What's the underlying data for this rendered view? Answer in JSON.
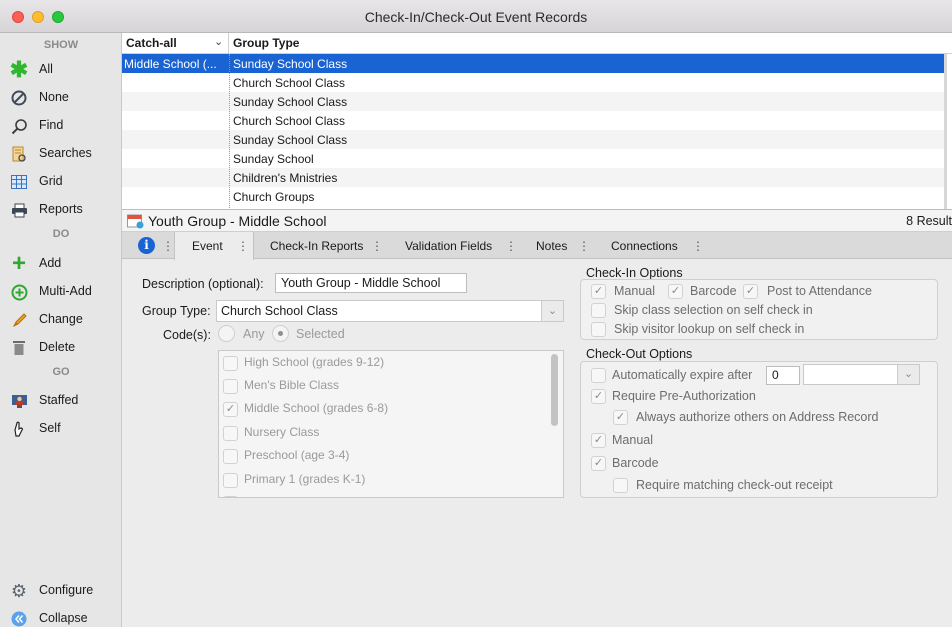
{
  "window": {
    "title": "Check-In/Check-Out Event Records"
  },
  "sidebar": {
    "show_heading": "SHOW",
    "do_heading": "DO",
    "go_heading": "GO",
    "show_items": [
      {
        "label": "All",
        "icon": "asterisk-icon"
      },
      {
        "label": "None",
        "icon": "none-icon"
      },
      {
        "label": "Find",
        "icon": "search-icon"
      },
      {
        "label": "Searches",
        "icon": "saved-searches-icon"
      },
      {
        "label": "Grid",
        "icon": "grid-icon"
      },
      {
        "label": "Reports",
        "icon": "printer-icon"
      }
    ],
    "do_items": [
      {
        "label": "Add",
        "icon": "plus-icon"
      },
      {
        "label": "Multi-Add",
        "icon": "multi-add-icon"
      },
      {
        "label": "Change",
        "icon": "pencil-icon"
      },
      {
        "label": "Delete",
        "icon": "trash-icon"
      }
    ],
    "go_items": [
      {
        "label": "Staffed",
        "icon": "staffed-icon"
      },
      {
        "label": "Self",
        "icon": "self-icon"
      }
    ],
    "bottom_items": [
      {
        "label": "Configure",
        "icon": "gear-icon"
      },
      {
        "label": "Collapse",
        "icon": "collapse-icon"
      }
    ]
  },
  "grid": {
    "columns": [
      "Catch-all",
      "Group Type"
    ],
    "rows": [
      {
        "catch_all": "Middle School (...",
        "group_type": "Sunday School Class",
        "selected": true
      },
      {
        "catch_all": "",
        "group_type": "Church School Class"
      },
      {
        "catch_all": "",
        "group_type": "Sunday School Class"
      },
      {
        "catch_all": "",
        "group_type": "Church School Class"
      },
      {
        "catch_all": "",
        "group_type": "Sunday School Class"
      },
      {
        "catch_all": "",
        "group_type": "Sunday School"
      },
      {
        "catch_all": "",
        "group_type": "Children's Mnistries"
      },
      {
        "catch_all": "",
        "group_type": "Church Groups"
      }
    ]
  },
  "record": {
    "title": "Youth Group - Middle School",
    "count": "8 Result"
  },
  "tabs": [
    "Event",
    "Check-In Reports",
    "Validation Fields",
    "Notes",
    "Connections"
  ],
  "event_form": {
    "description_label": "Description (optional):",
    "description_value": "Youth Group - Middle School",
    "group_type_label": "Group Type:",
    "group_type_value": "Church School Class",
    "codes_label": "Code(s):",
    "codes_any": "Any",
    "codes_selected": "Selected",
    "code_list": [
      {
        "label": "High School (grades 9-12)",
        "checked": false
      },
      {
        "label": "Men's Bible Class",
        "checked": false
      },
      {
        "label": "Middle School (grades 6-8)",
        "checked": true
      },
      {
        "label": "Nursery Class",
        "checked": false
      },
      {
        "label": "Preschool (age 3-4)",
        "checked": false
      },
      {
        "label": "Primary 1 (grades K-1)",
        "checked": false
      }
    ]
  },
  "checkin_options": {
    "title": "Check-In Options",
    "manual": "Manual",
    "barcode": "Barcode",
    "post_attendance": "Post to Attendance",
    "skip_class": "Skip class selection on self check in",
    "skip_visitor": "Skip visitor lookup on self check in"
  },
  "checkout_options": {
    "title": "Check-Out Options",
    "auto_expire": "Automatically expire after",
    "auto_expire_value": "0",
    "require_preauth": "Require Pre-Authorization",
    "always_authorize": "Always authorize others on Address Record",
    "manual": "Manual",
    "barcode": "Barcode",
    "require_receipt": "Require matching check-out receipt"
  }
}
